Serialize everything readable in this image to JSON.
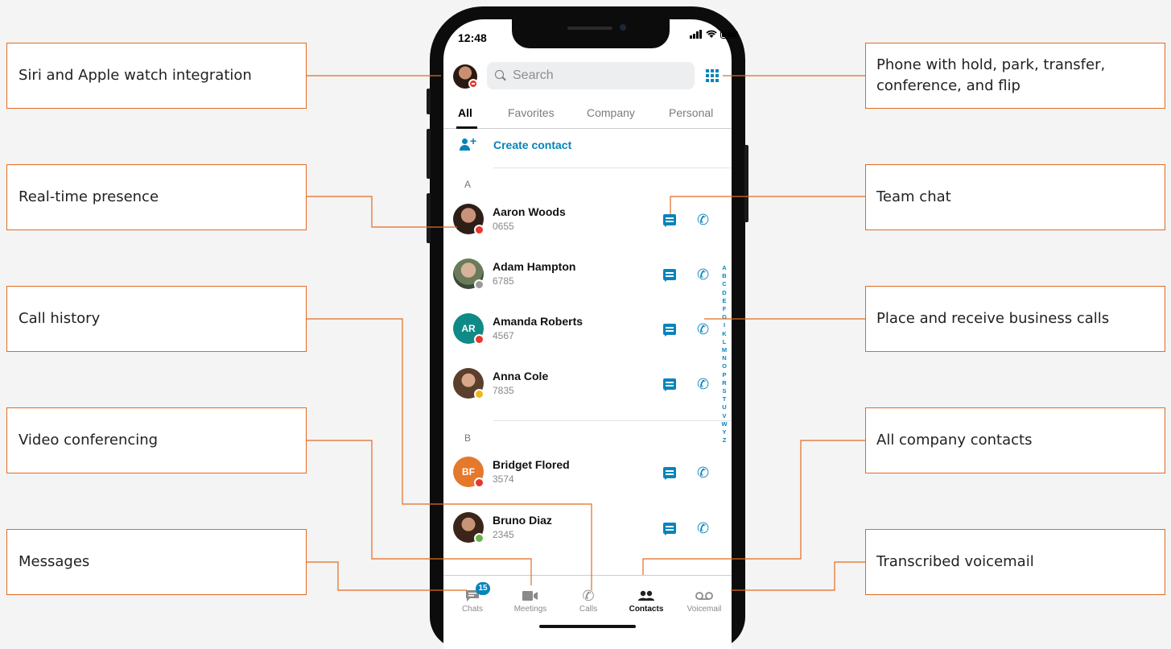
{
  "callouts": {
    "siri": "Siri and Apple watch integration",
    "presence": "Real-time presence",
    "history": "Call history",
    "video": "Video conferencing",
    "messages": "Messages",
    "phone": "Phone with hold, park, transfer, conference, and flip",
    "team_chat": "Team chat",
    "business_calls": "Place and receive business calls",
    "company_contacts": "All company contacts",
    "voicemail": "Transcribed voicemail"
  },
  "status_bar": {
    "time": "12:48"
  },
  "search": {
    "placeholder": "Search"
  },
  "tabs": [
    "All",
    "Favorites",
    "Company",
    "Personal"
  ],
  "create_contact": "Create contact",
  "sections": [
    "A",
    "B"
  ],
  "contacts": [
    {
      "name": "Aaron Woods",
      "ext": "0655",
      "initials": "",
      "presence": "do-not-disturb"
    },
    {
      "name": "Adam Hampton",
      "ext": "6785",
      "initials": "",
      "presence": "offline"
    },
    {
      "name": "Amanda Roberts",
      "ext": "4567",
      "initials": "AR",
      "presence": "on-call"
    },
    {
      "name": "Anna Cole",
      "ext": "7835",
      "initials": "",
      "presence": "away"
    },
    {
      "name": "Bridget Flored",
      "ext": "3574",
      "initials": "BF",
      "presence": "busy"
    },
    {
      "name": "Bruno Diaz",
      "ext": "2345",
      "initials": "",
      "presence": "available"
    }
  ],
  "alphabet": [
    "A",
    "B",
    "C",
    "D",
    "E",
    "F",
    "G",
    "I",
    "K",
    "L",
    "M",
    "N",
    "O",
    "P",
    "R",
    "S",
    "T",
    "U",
    "V",
    "W",
    "Y",
    "Z"
  ],
  "tabbar": {
    "chats": "Chats",
    "chats_badge": "15",
    "meetings": "Meetings",
    "calls": "Calls",
    "contacts": "Contacts",
    "voicemail": "Voicemail"
  },
  "colors": {
    "accent": "#0684bc",
    "callout_border": "#e26b21",
    "presence_busy": "#e3392f",
    "presence_away": "#f2b51a",
    "presence_available": "#6ab04c",
    "presence_offline": "#9a9a9a"
  }
}
